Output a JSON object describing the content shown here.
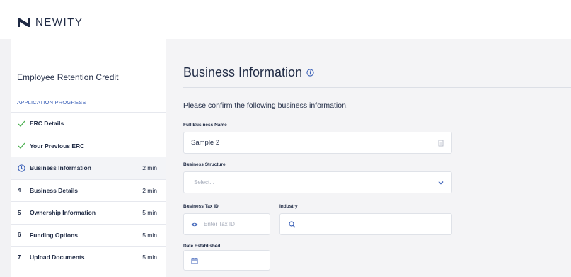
{
  "brand": {
    "name": "NEWITY"
  },
  "sidebar": {
    "title": "Employee Retention Credit",
    "progress_label": "APPLICATION PROGRESS",
    "steps": [
      {
        "lead": "check",
        "label": "ERC Details",
        "time": ""
      },
      {
        "lead": "check",
        "label": "Your Previous ERC",
        "time": ""
      },
      {
        "lead": "clock",
        "label": "Business Information",
        "time": "2 min"
      },
      {
        "lead": "4",
        "label": "Business Details",
        "time": "2 min"
      },
      {
        "lead": "5",
        "label": "Ownership Information",
        "time": "5 min"
      },
      {
        "lead": "6",
        "label": "Funding Options",
        "time": "5 min"
      },
      {
        "lead": "7",
        "label": "Upload Documents",
        "time": "5 min"
      }
    ]
  },
  "main": {
    "title": "Business Information",
    "prompt": "Please confirm the following business information.",
    "fields": {
      "full_business_name": {
        "label": "Full Business Name",
        "value": "Sample 2"
      },
      "business_structure": {
        "label": "Business Structure",
        "placeholder": "Select..."
      },
      "business_tax_id": {
        "label": "Business Tax ID",
        "placeholder": "Enter Tax ID"
      },
      "industry": {
        "label": "Industry",
        "value": ""
      },
      "date_established": {
        "label": "Date Established",
        "value": ""
      }
    }
  },
  "colors": {
    "accent": "#3d62b8",
    "check": "#4caf50",
    "text": "#1f2a44"
  }
}
